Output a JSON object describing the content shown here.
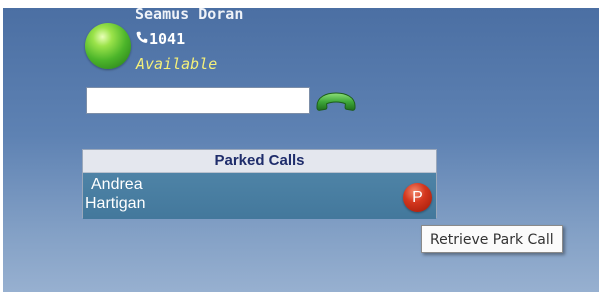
{
  "user": {
    "name": "Seamus Doran",
    "extension": "1041",
    "status": "Available"
  },
  "dialer": {
    "value": "",
    "call_icon": "phone-handset-icon"
  },
  "parked_calls": {
    "title": "Parked Calls",
    "items": [
      {
        "first_name": "Andrea",
        "last_name": "Hartigan",
        "badge": "P"
      }
    ]
  },
  "tooltip": {
    "text": "Retrieve Park Call"
  },
  "colors": {
    "status_available": "#4cb52a",
    "status_text": "#f5f07a",
    "park_badge": "#d4371e",
    "header_text": "#1f2d6b",
    "call_button": "#3fa83a"
  }
}
